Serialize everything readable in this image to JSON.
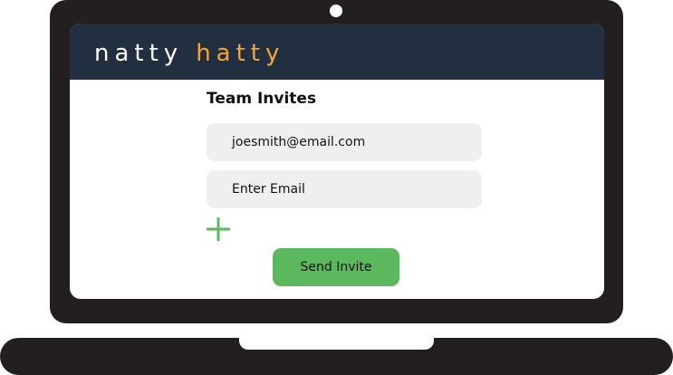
{
  "app": {
    "logo_part1": "natty",
    "logo_part2": "hatty",
    "logo_part2_color": "#f7a532",
    "header_color": "#222f40"
  },
  "form": {
    "title": "Team Invites",
    "email_value": "joesmith@email.com",
    "email_placeholder": "Enter Email",
    "add_icon": "plus-icon",
    "send_label": "Send Invite",
    "accent_color": "#5cb85c"
  }
}
